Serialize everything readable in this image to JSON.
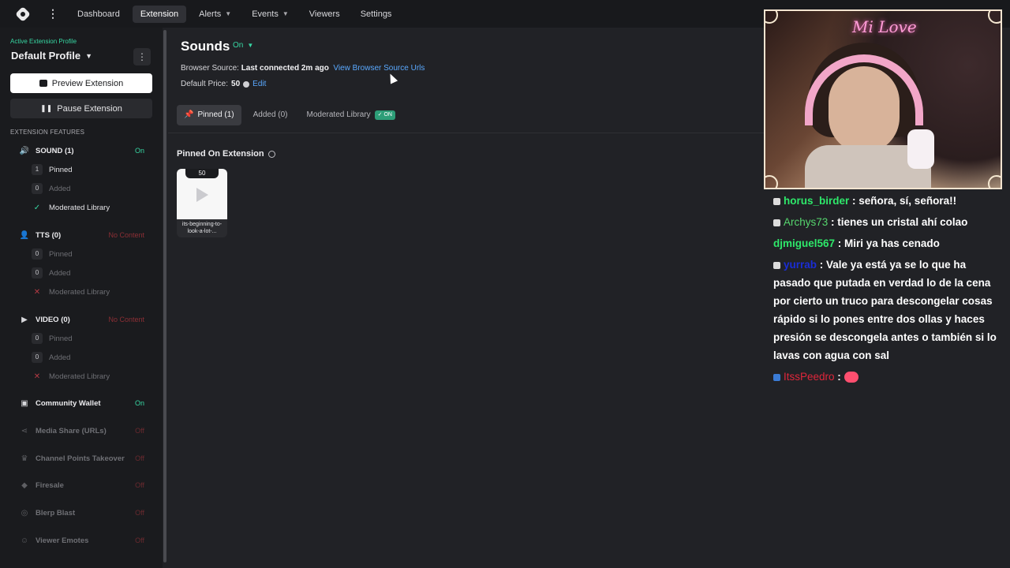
{
  "topbar": {
    "nav": [
      {
        "label": "Dashboard"
      },
      {
        "label": "Extension"
      },
      {
        "label": "Alerts"
      },
      {
        "label": "Events"
      },
      {
        "label": "Viewers"
      },
      {
        "label": "Settings"
      }
    ]
  },
  "sidebar": {
    "profile_label": "Active Extension Profile",
    "profile_name": "Default Profile",
    "preview_button": "Preview Extension",
    "pause_button": "Pause Extension",
    "features_label": "EXTENSION FEATURES",
    "sound": {
      "name": "SOUND (1)",
      "status": "On",
      "pinned_count": "1",
      "pinned": "Pinned",
      "added_count": "0",
      "added": "Added",
      "library": "Moderated Library"
    },
    "tts": {
      "name": "TTS (0)",
      "status": "No Content",
      "pinned_count": "0",
      "pinned": "Pinned",
      "added_count": "0",
      "added": "Added",
      "library": "Moderated Library"
    },
    "video": {
      "name": "VIDEO (0)",
      "status": "No Content",
      "pinned_count": "0",
      "pinned": "Pinned",
      "added_count": "0",
      "added": "Added",
      "library": "Moderated Library"
    },
    "wallet": {
      "name": "Community Wallet",
      "status": "On"
    },
    "media_share": {
      "name": "Media Share (URLs)",
      "status": "Off"
    },
    "channel_points": {
      "name": "Channel Points Takeover",
      "status": "Off"
    },
    "firesale": {
      "name": "Firesale",
      "status": "Off"
    },
    "blerp_blast": {
      "name": "Blerp Blast",
      "status": "Off"
    },
    "viewer_emotes": {
      "name": "Viewer Emotes",
      "status": "Off"
    }
  },
  "main": {
    "title": "Sounds",
    "toggle": "On",
    "browser_source_label": "Browser Source: ",
    "browser_source_value": "Last connected 2m ago",
    "browser_source_link": "View Browser Source Urls",
    "price_label": "Default Price: ",
    "price_value": "50",
    "edit_link": "Edit",
    "tabs": [
      {
        "label": "Pinned (1)"
      },
      {
        "label": "Added (0)"
      },
      {
        "label": "Moderated Library",
        "badge": "ON"
      }
    ],
    "pinned_heading": "Pinned On Extension",
    "card": {
      "price": "50",
      "name": "its-beginning-to-look-a-lot-..."
    }
  },
  "stream": {
    "neon_sign": "Mi Love",
    "chat": [
      {
        "user": "horus_birder",
        "text": " : señora, sí, señora!!"
      },
      {
        "user": "Archys73",
        "text": " : tienes un cristal ahí colao"
      },
      {
        "user": "djmiguel567",
        "text": " : Miri ya has cenado"
      },
      {
        "user": "yurrab",
        "text": " : Vale ya está ya se lo que ha pasado que putada en verdad lo de la cena por cierto un truco para descongelar cosas rápido si lo pones entre dos ollas y haces presión se descongela antes o también si lo lavas con agua con sal"
      },
      {
        "user": "ItssPeedro",
        "text": " : "
      }
    ]
  }
}
